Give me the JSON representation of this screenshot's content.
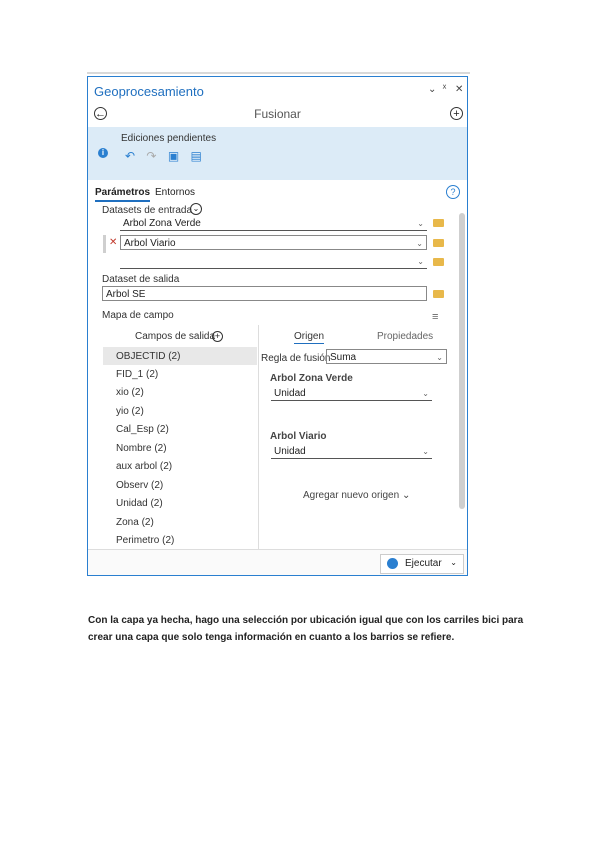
{
  "pane": {
    "title": "Geoprocesamiento",
    "controls": [
      "⌄",
      "ᕁ",
      "✕"
    ],
    "tool_title": "Fusionar"
  },
  "pending": {
    "title": "Ediciones pendientes"
  },
  "tabs": {
    "params": "Parámetros",
    "envs": "Entornos",
    "help": "?"
  },
  "inputs": {
    "label": "Datasets de entrada",
    "items": [
      "Arbol Zona Verde",
      "Arbol Viario",
      ""
    ]
  },
  "output": {
    "label": "Dataset de salida",
    "value": "Arbol SE"
  },
  "fieldmap": {
    "label": "Mapa de campo",
    "output_fields_header": "Campos de salida",
    "origin_tab": "Origen",
    "props_tab": "Propiedades",
    "fields": [
      "OBJECTID  (2)",
      "FID_1  (2)",
      "xio  (2)",
      "yio  (2)",
      "Cal_Esp  (2)",
      "Nombre  (2)",
      "aux arbol  (2)",
      "Observ  (2)",
      "Unidad  (2)",
      "Zona  (2)",
      "Perimetro  (2)"
    ],
    "merge_rule_label": "Regla de fusión",
    "merge_rule_value": "Suma",
    "sources": [
      {
        "name": "Arbol Zona Verde",
        "field": "Unidad"
      },
      {
        "name": "Arbol Viario",
        "field": "Unidad"
      }
    ],
    "add_source": "Agregar nuevo origen"
  },
  "run": {
    "label": "Ejecutar"
  },
  "caption": {
    "line1": "Con la capa ya hecha, hago una selección por ubicación igual que con los carriles bici para",
    "line2": "crear una capa que solo tenga información en cuanto a los barrios se refiere."
  }
}
